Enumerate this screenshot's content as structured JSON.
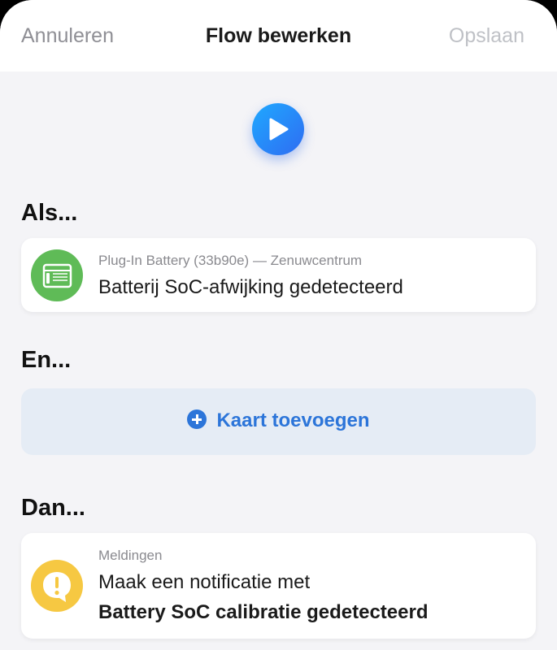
{
  "header": {
    "cancel_label": "Annuleren",
    "title": "Flow bewerken",
    "save_label": "Opslaan"
  },
  "sections": {
    "if_label": "Als...",
    "and_label": "En...",
    "then_label": "Dan..."
  },
  "trigger_card": {
    "device": "Plug-In Battery (33b90e) — Zenuwcentrum",
    "title": "Batterij SoC-afwijking gedetecteerd",
    "icon": "battery-device-icon",
    "icon_color": "#5fbb57"
  },
  "add_card": {
    "label": "Kaart toevoegen",
    "icon": "plus-circle-icon",
    "color": "#2c75d9"
  },
  "action_card": {
    "category": "Meldingen",
    "line1": "Maak een notificatie met",
    "line2": "Battery SoC calibratie gedetecteerd",
    "icon": "notification-icon",
    "icon_color": "#f6c842"
  },
  "play_button": {
    "icon": "play-icon",
    "color": "#2f7cf0"
  }
}
